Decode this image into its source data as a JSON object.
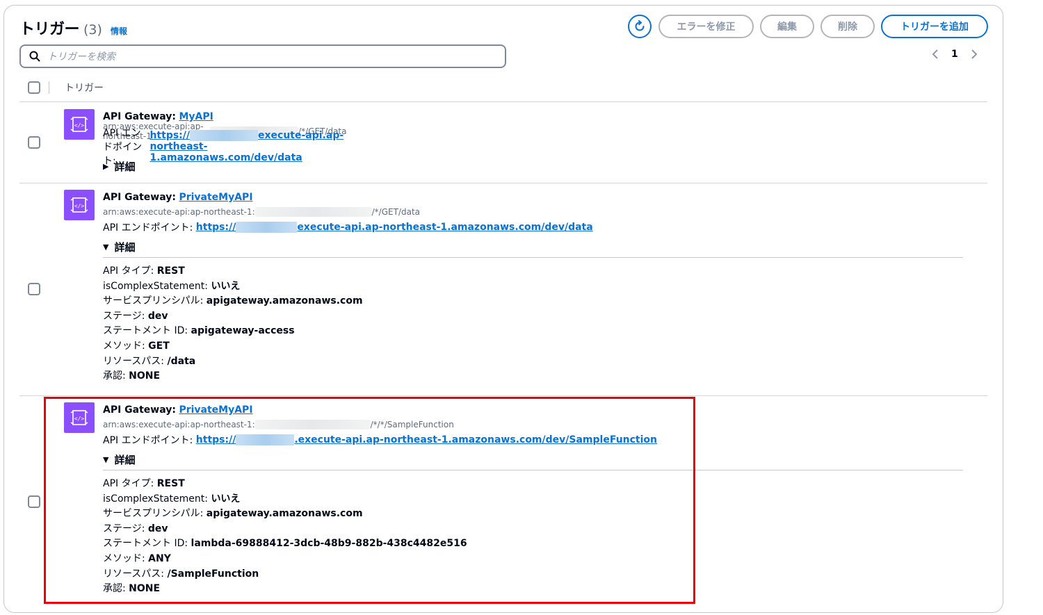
{
  "header": {
    "title": "トリガー",
    "count": "(3)",
    "info_link": "情報"
  },
  "toolbar": {
    "refresh_icon": "refresh-icon",
    "fix_errors_label": "エラーを修正",
    "edit_label": "編集",
    "delete_label": "削除",
    "add_trigger_label": "トリガーを追加"
  },
  "search": {
    "placeholder": "トリガーを検索"
  },
  "pagination": {
    "current_page": "1"
  },
  "table": {
    "column_header": "トリガー"
  },
  "colors": {
    "accent": "#0972d3",
    "gateway_icon": "#8c4fff",
    "highlight": "#e8000b"
  },
  "triggers": [
    {
      "source_label": "API Gateway:",
      "api_name": "MyAPI",
      "arn_prefix": "arn:aws:execute-api:ap-northeast-1",
      "arn_suffix": "/*/GET/data",
      "endpoint_label": "API エンドポイント:",
      "endpoint_prefix": "https://",
      "endpoint_suffix": "execute-api.ap-northeast-1.amazonaws.com/dev/data",
      "details_label": "詳細",
      "expanded": false
    },
    {
      "source_label": "API Gateway:",
      "api_name": "PrivateMyAPI",
      "arn_prefix": "arn:aws:execute-api:ap-northeast-1:",
      "arn_suffix": "/*/GET/data",
      "endpoint_label": "API エンドポイント:",
      "endpoint_prefix": "https://",
      "endpoint_suffix": "execute-api.ap-northeast-1.amazonaws.com/dev/data",
      "details_label": "詳細",
      "expanded": true,
      "details": [
        {
          "key": "API タイプ:",
          "value": "REST"
        },
        {
          "key": "isComplexStatement:",
          "value": "いいえ"
        },
        {
          "key": "サービスプリンシパル:",
          "value": "apigateway.amazonaws.com"
        },
        {
          "key": "ステージ:",
          "value": "dev"
        },
        {
          "key": "ステートメント ID:",
          "value": "apigateway-access"
        },
        {
          "key": "メソッド:",
          "value": "GET"
        },
        {
          "key": "リソースパス:",
          "value": "/data"
        },
        {
          "key": "承認:",
          "value": "NONE"
        }
      ]
    },
    {
      "source_label": "API Gateway:",
      "api_name": "PrivateMyAPI",
      "arn_prefix": "arn:aws:execute-api:ap-northeast-1:",
      "arn_suffix": "/*/*/SampleFunction",
      "endpoint_label": "API エンドポイント:",
      "endpoint_prefix": "https://",
      "endpoint_suffix": ".execute-api.ap-northeast-1.amazonaws.com/dev/SampleFunction",
      "details_label": "詳細",
      "expanded": true,
      "details": [
        {
          "key": "API タイプ:",
          "value": "REST"
        },
        {
          "key": "isComplexStatement:",
          "value": "いいえ"
        },
        {
          "key": "サービスプリンシパル:",
          "value": "apigateway.amazonaws.com"
        },
        {
          "key": "ステージ:",
          "value": "dev"
        },
        {
          "key": "ステートメント ID:",
          "value": "lambda-69888412-3dcb-48b9-882b-438c4482e516"
        },
        {
          "key": "メソッド:",
          "value": "ANY"
        },
        {
          "key": "リソースパス:",
          "value": "/SampleFunction"
        },
        {
          "key": "承認:",
          "value": "NONE"
        }
      ]
    }
  ]
}
